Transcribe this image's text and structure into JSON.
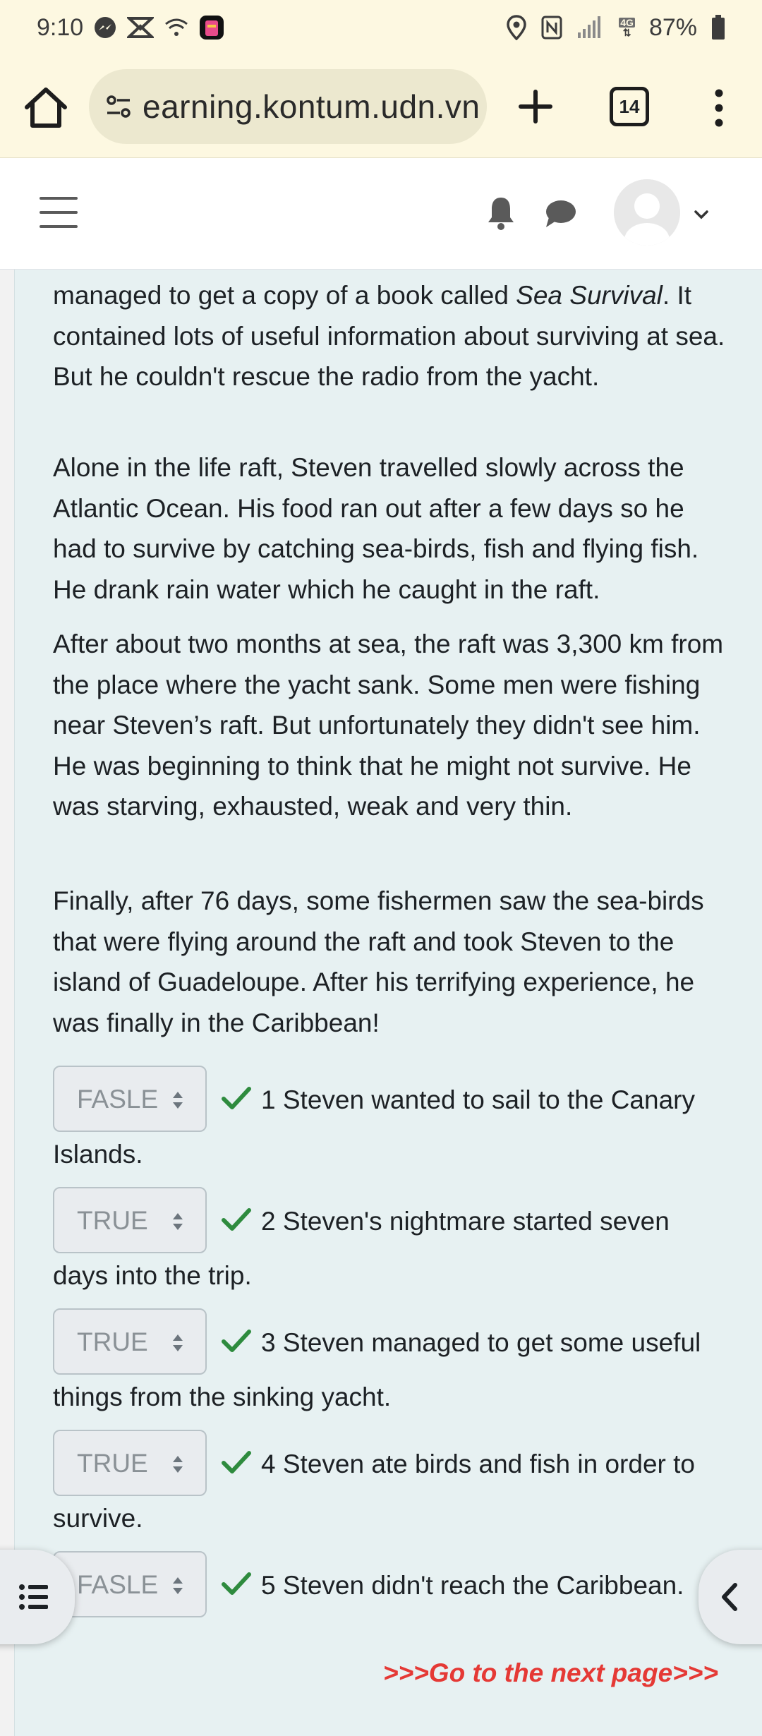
{
  "status_bar": {
    "time": "9:10",
    "battery": "87%",
    "network": "4G",
    "icons": [
      "messenger-icon",
      "app-notification-icon",
      "wifi-calling-icon",
      "app-icon",
      "location-icon",
      "nfc-icon",
      "signal-icon",
      "battery-icon"
    ]
  },
  "browser": {
    "url": "earning.kontum.udn.vn",
    "tab_count": "14"
  },
  "article": {
    "p1_lead": "managed to get a copy of a book called ",
    "p1_italic": "Sea Survival",
    "p1_rest": ". It contained lots of useful information about surviving at sea. But he couldn't rescue the radio from the yacht.",
    "p2": "Alone in the life raft, Steven travelled slowly across the Atlantic Ocean. His food ran out after a few days so he had to survive by catching sea-birds, fish and flying fish. He drank rain water which he caught in the raft.",
    "p3": "After about two months at sea, the raft was 3,300 km from the place where the yacht sank. Some men were fishing near Steven’s raft. But unfortunately they didn't see him. He was beginning to think that he might not survive. He was starving, exhausted, weak and very thin.",
    "p4": "Finally, after 76 days, some fishermen saw the sea-birds that were flying around the raft and took Steven to the island of Guadeloupe. After his terrifying experience, he was finally in the Caribbean!"
  },
  "questions": [
    {
      "answer": "FASLE",
      "text": "1 Steven wanted to sail to the Canary Islands."
    },
    {
      "answer": "TRUE",
      "text": "2 Steven's nightmare started seven days into the trip."
    },
    {
      "answer": "TRUE",
      "text": "3 Steven managed to get some useful things from the sinking yacht."
    },
    {
      "answer": "TRUE",
      "text": "4 Steven ate birds and fish in order to survive."
    },
    {
      "answer": "FASLE",
      "text": "5 Steven didn't reach the Caribbean."
    }
  ],
  "next_link": ">>>Go to the next page>>>"
}
